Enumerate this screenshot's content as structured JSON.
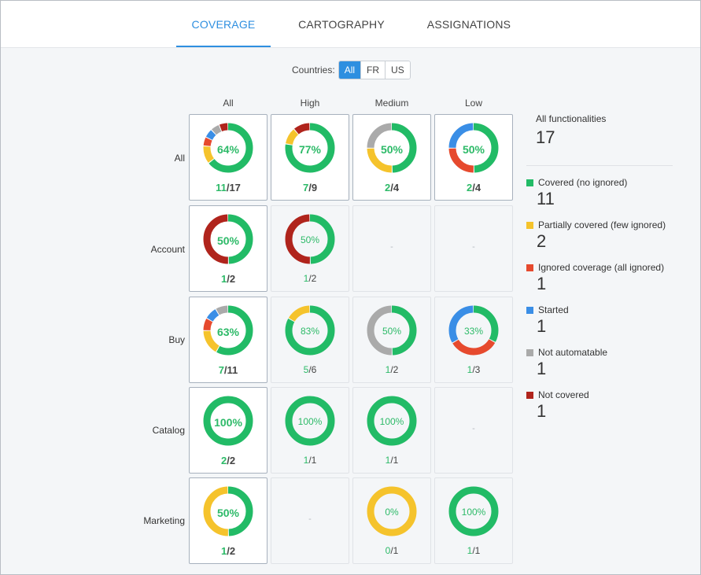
{
  "tabs": [
    {
      "label": "COVERAGE",
      "active": true
    },
    {
      "label": "CARTOGRAPHY",
      "active": false
    },
    {
      "label": "ASSIGNATIONS",
      "active": false
    }
  ],
  "countries": {
    "label": "Countries:",
    "options": [
      "All",
      "FR",
      "US"
    ],
    "selected": "All"
  },
  "colors": {
    "covered": "#22bb66",
    "partial": "#f5c32c",
    "ignored": "#e64a2e",
    "started": "#3a8ee6",
    "not_automatable": "#aaaaaa",
    "not_covered": "#b0241c"
  },
  "columns": [
    "All",
    "High",
    "Medium",
    "Low"
  ],
  "rows": [
    {
      "label": "All",
      "cells": [
        {
          "percent": "64%",
          "done": "11",
          "total": "17",
          "segments": {
            "covered": 11,
            "partial": 2,
            "ignored": 1,
            "started": 1,
            "not_automatable": 1,
            "not_covered": 1
          }
        },
        {
          "percent": "77%",
          "done": "7",
          "total": "9",
          "segments": {
            "covered": 7,
            "partial": 1,
            "not_covered": 1
          }
        },
        {
          "percent": "50%",
          "done": "2",
          "total": "4",
          "segments": {
            "covered": 2,
            "partial": 1,
            "not_automatable": 1
          }
        },
        {
          "percent": "50%",
          "done": "2",
          "total": "4",
          "segments": {
            "covered": 2,
            "ignored": 1,
            "started": 1
          }
        }
      ]
    },
    {
      "label": "Account",
      "cells": [
        {
          "percent": "50%",
          "done": "1",
          "total": "2",
          "segments": {
            "covered": 1,
            "not_covered": 1
          }
        },
        {
          "percent": "50%",
          "done": "1",
          "total": "2",
          "segments": {
            "covered": 1,
            "not_covered": 1
          }
        },
        {
          "empty": true,
          "dash": "-"
        },
        {
          "empty": true,
          "dash": "-"
        }
      ]
    },
    {
      "label": "Buy",
      "cells": [
        {
          "percent": "63%",
          "done": "7",
          "total": "11",
          "segments": {
            "covered": 7,
            "partial": 2,
            "ignored": 1,
            "started": 1,
            "not_automatable": 1
          }
        },
        {
          "percent": "83%",
          "done": "5",
          "total": "6",
          "segments": {
            "covered": 5,
            "partial": 1
          }
        },
        {
          "percent": "50%",
          "done": "1",
          "total": "2",
          "segments": {
            "covered": 1,
            "not_automatable": 1
          }
        },
        {
          "percent": "33%",
          "done": "1",
          "total": "3",
          "segments": {
            "covered": 1,
            "ignored": 1,
            "started": 1
          }
        }
      ]
    },
    {
      "label": "Catalog",
      "cells": [
        {
          "percent": "100%",
          "done": "2",
          "total": "2",
          "segments": {
            "covered": 2
          }
        },
        {
          "percent": "100%",
          "done": "1",
          "total": "1",
          "segments": {
            "covered": 1
          }
        },
        {
          "percent": "100%",
          "done": "1",
          "total": "1",
          "segments": {
            "covered": 1
          }
        },
        {
          "empty": true,
          "dash": "-"
        }
      ]
    },
    {
      "label": "Marketing",
      "cells": [
        {
          "percent": "50%",
          "done": "1",
          "total": "2",
          "segments": {
            "covered": 1,
            "partial": 1
          }
        },
        {
          "empty": true,
          "dash": "-"
        },
        {
          "percent": "0%",
          "done": "0",
          "total": "1",
          "segments": {
            "partial": 1
          }
        },
        {
          "percent": "100%",
          "done": "1",
          "total": "1",
          "segments": {
            "covered": 1
          }
        }
      ]
    }
  ],
  "legend": {
    "total_label": "All functionalities",
    "total_value": "17",
    "items": [
      {
        "key": "covered",
        "label": "Covered (no ignored)",
        "value": "11"
      },
      {
        "key": "partial",
        "label": "Partially covered (few ignored)",
        "value": "2"
      },
      {
        "key": "ignored",
        "label": "Ignored coverage (all ignored)",
        "value": "1"
      },
      {
        "key": "started",
        "label": "Started",
        "value": "1"
      },
      {
        "key": "not_automatable",
        "label": "Not automatable",
        "value": "1"
      },
      {
        "key": "not_covered",
        "label": "Not covered",
        "value": "1"
      }
    ]
  }
}
